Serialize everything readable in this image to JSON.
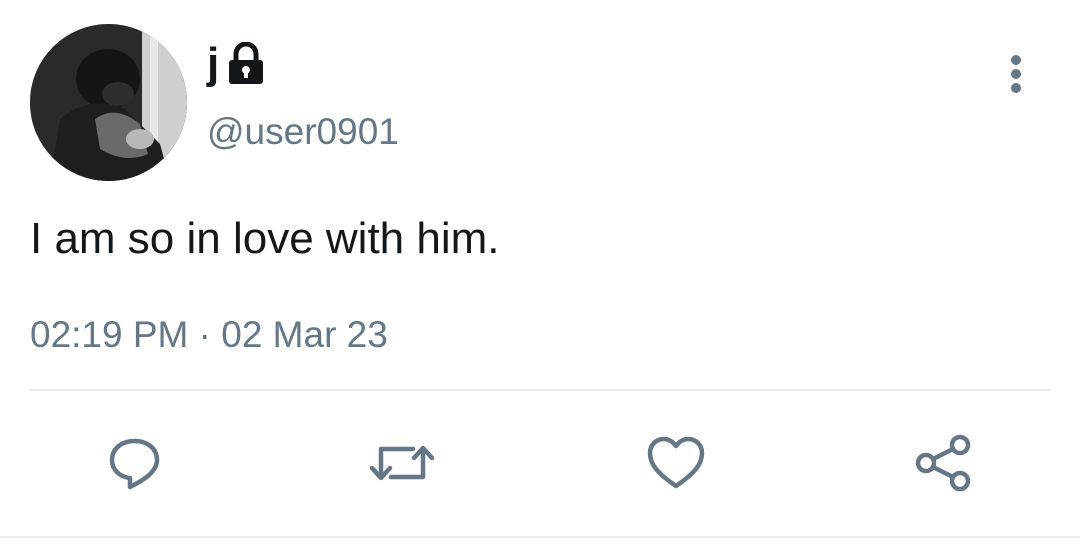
{
  "tweet": {
    "display_name": "j",
    "handle": "@user0901",
    "text": "I am so in love with him.",
    "timestamp": "02:19 PM · 02 Mar 23",
    "icons": {
      "lock": "lock-icon",
      "more": "more-vertical-icon",
      "reply": "reply-icon",
      "retweet": "retweet-icon",
      "like": "heart-icon",
      "share": "share-icon"
    },
    "colors": {
      "text": "#14171a",
      "secondary": "#657786",
      "divider": "#e6ecf0"
    }
  }
}
